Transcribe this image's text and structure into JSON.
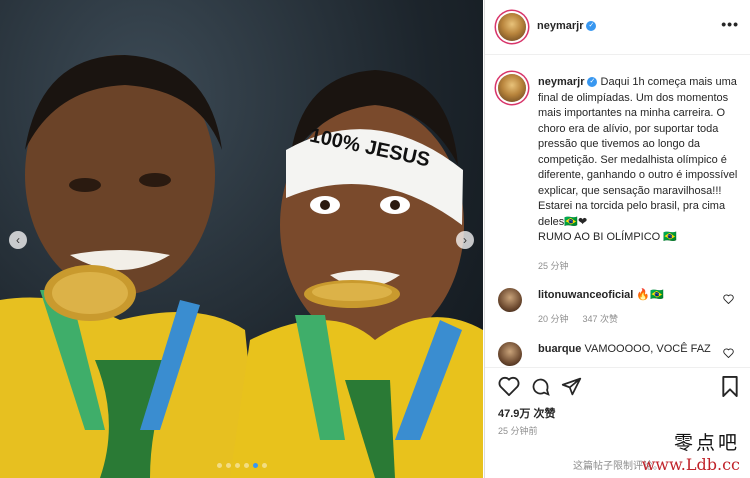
{
  "post": {
    "image_alt": "Two Brazilian athletes in yellow jerseys biting gold medals; one wears a headband reading 100% JESUS",
    "headband_text": "100% JESUS",
    "carousel_dots": 6,
    "active_dot": 5
  },
  "header": {
    "username": "neymarjr",
    "more_label": "•••"
  },
  "caption": {
    "username": "neymarjr",
    "lines": [
      "Daqui 1h começa mais uma final de olimpíadas. Um dos momentos mais importantes na minha carreira. O choro era de alívio, por suportar toda pressão que tivemos ao longo da competição. Ser medalhista olímpico é diferente, ganhando o outro é impossível explicar, que sensação maravilhosa!!!",
      "Estarei na torcida pelo brasil, pra cima deles🇧🇷❤",
      "RUMO AO BI OLÍMPICO 🇧🇷"
    ],
    "time": "25 分钟"
  },
  "comments": [
    {
      "username": "litonuwanceoficial",
      "text": "🔥🇧🇷",
      "time": "20 分钟",
      "likes": "347 次赞"
    },
    {
      "username": "buarque",
      "text": "VAMOOOOO, VOCÊ FAZ E FEZ PARTE DISSO 🇧🇷🇧🇷🇧🇷",
      "time": "",
      "likes": ""
    }
  ],
  "actions": {
    "likes": "47.9万 次赞",
    "time": "25 分钟前",
    "comments_limited": "这篇帖子限制评论。"
  },
  "watermark": {
    "top": "零点吧",
    "bottom": "www.Ldb.cc"
  },
  "colors": {
    "accent": "#3897f0",
    "story_ring": "#d8356a",
    "watermark_red": "#c0232a"
  }
}
